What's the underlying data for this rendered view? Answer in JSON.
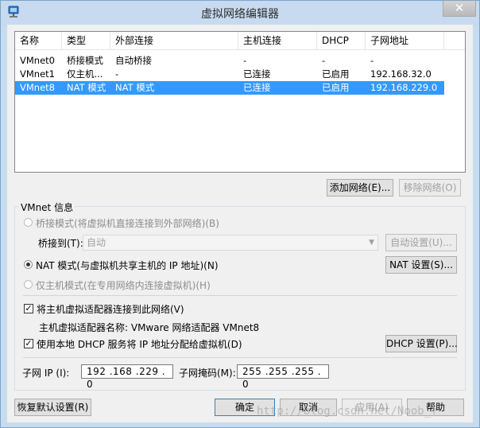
{
  "window": {
    "title": "虚拟网络编辑器",
    "close_glyph": "✕"
  },
  "table": {
    "columns": [
      "名称",
      "类型",
      "外部连接",
      "主机连接",
      "DHCP",
      "子网地址"
    ],
    "rows": [
      [
        "VMnet0",
        "桥接模式",
        "自动桥接",
        "-",
        "-",
        "-"
      ],
      [
        "VMnet1",
        "仅主机...",
        "-",
        "已连接",
        "已启用",
        "192.168.32.0"
      ],
      [
        "VMnet8",
        "NAT 模式",
        "NAT 模式",
        "已连接",
        "已启用",
        "192.168.229.0"
      ]
    ],
    "selected_row": 2
  },
  "buttons": {
    "add_network": "添加网络(E)...",
    "remove_network": "移除网络(O)",
    "auto_settings": "自动设置(U)...",
    "nat_settings": "NAT 设置(S)...",
    "dhcp_settings": "DHCP 设置(P)...",
    "restore_defaults": "恢复默认设置(R)",
    "ok": "确定",
    "cancel": "取消",
    "apply": "应用(A)",
    "help": "帮助"
  },
  "vmnet_info": {
    "group_title": "VMnet 信息",
    "bridged_radio": "桥接模式(将虚拟机直接连接到外部网络)(B)",
    "bridged_to_label": "桥接到(T):",
    "bridged_to_value": "自动",
    "nat_radio": "NAT 模式(与虚拟机共享主机的 IP 地址)(N)",
    "host_only_radio": "仅主机模式(在专用网络内连接虚拟机)(H)",
    "selected_mode": "nat",
    "connect_adapter_checkbox": "将主机虚拟适配器连接到此网络(V)",
    "connect_adapter_checked": true,
    "adapter_name_text": "主机虚拟适配器名称: VMware 网络适配器 VMnet8",
    "dhcp_checkbox": "使用本地 DHCP 服务将 IP 地址分配给虚拟机(D)",
    "dhcp_checked": true,
    "subnet_ip_label": "子网 IP (I):",
    "subnet_ip_value": "192 .168 .229 . 0",
    "subnet_mask_label": "子网掩码(M):",
    "subnet_mask_value": "255 .255 .255 . 0"
  },
  "watermark": "http://blog.csdn.net/Noob_f",
  "check_glyph": "✓",
  "dropdown_glyph": "▼"
}
